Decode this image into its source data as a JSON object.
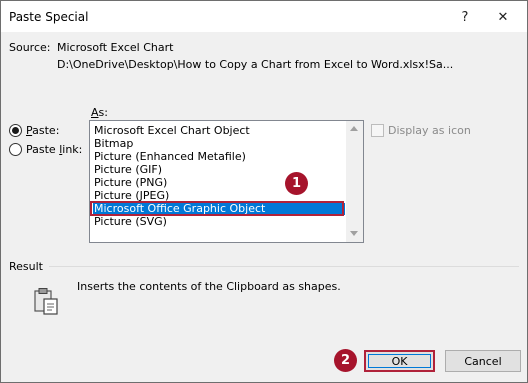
{
  "window": {
    "title": "Paste Special",
    "help_glyph": "?",
    "close_glyph": "✕"
  },
  "source": {
    "label": "Source:",
    "name": "Microsoft Excel Chart",
    "path": "D:\\OneDrive\\Desktop\\How to Copy a Chart from Excel to Word.xlsx!Sa..."
  },
  "as_label": "As:",
  "paste_options": [
    {
      "label": "Paste:",
      "checked": true
    },
    {
      "label": "Paste link:",
      "checked": false
    }
  ],
  "formats": [
    "Microsoft Excel Chart Object",
    "Bitmap",
    "Picture (Enhanced Metafile)",
    "Picture (GIF)",
    "Picture (PNG)",
    "Picture (JPEG)",
    "Microsoft Office Graphic Object",
    "Picture (SVG)"
  ],
  "selected_format_index": 6,
  "display_as_icon": {
    "label": "Display as icon",
    "checked": false,
    "enabled": false
  },
  "result": {
    "label": "Result",
    "text": "Inserts the contents of the Clipboard as shapes.",
    "icon": "clipboard-icon"
  },
  "buttons": {
    "ok": "OK",
    "cancel": "Cancel"
  },
  "annotations": [
    "1",
    "2"
  ],
  "colors": {
    "selection": "#0078d7",
    "highlight": "#b0223a",
    "badge": "#a6142c"
  }
}
